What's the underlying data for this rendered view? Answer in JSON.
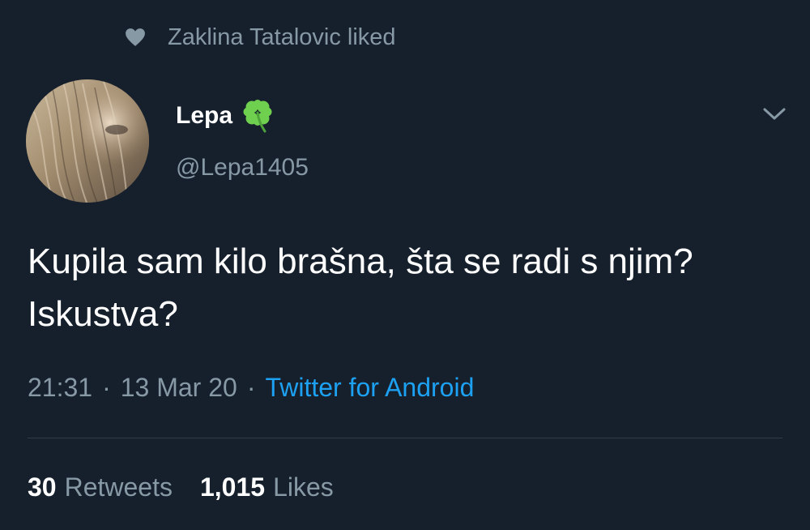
{
  "social_context": {
    "icon": "heart-icon",
    "text": "Zaklina Tatalovic liked"
  },
  "author": {
    "display_name": "Lepa",
    "badge_icon": "four-leaf-clover-icon",
    "handle": "@Lepa1405"
  },
  "tweet": {
    "text": "Kupila sam kilo brašna, šta se radi s njim? Iskustva?",
    "time": "21:31",
    "date": "13 Mar 20",
    "separator": "·",
    "source": "Twitter for Android"
  },
  "stats": {
    "retweets_count": "30",
    "retweets_label": "Retweets",
    "likes_count": "1,015",
    "likes_label": "Likes"
  },
  "colors": {
    "background": "#16202c",
    "secondary_text": "#8899a6",
    "link": "#1da1f2",
    "clover": "#6fcf4f"
  }
}
